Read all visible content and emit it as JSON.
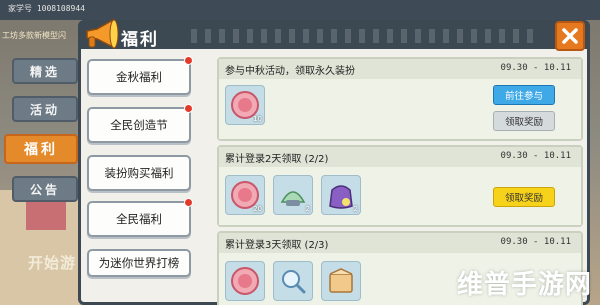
{
  "background": {
    "top_text": "家学号 1008108944",
    "sub_text": "工坊多款新模型闪",
    "start_text": "开始游"
  },
  "side_nav": [
    {
      "label": "精选",
      "active": false
    },
    {
      "label": "活动",
      "active": false
    },
    {
      "label": "福利",
      "active": true
    },
    {
      "label": "公告",
      "active": false
    }
  ],
  "panel": {
    "title": "福利",
    "close_icon": "close-x-icon"
  },
  "categories": [
    {
      "label": "金秋福利",
      "has_dot": true
    },
    {
      "label": "全民创造节",
      "has_dot": true
    },
    {
      "label": "装扮购买福利",
      "has_dot": false
    },
    {
      "label": "全民福利",
      "has_dot": true
    },
    {
      "label": "为迷你世界打榜",
      "has_dot": false
    }
  ],
  "cards": [
    {
      "title": "参与中秋活动，领取永久装扮",
      "date": "09.30 - 10.11",
      "items": [
        {
          "icon": "pink-coin-icon",
          "count": "10"
        }
      ],
      "buttons": [
        {
          "label": "前往参与",
          "style": "blue"
        },
        {
          "label": "领取奖励",
          "style": "gray"
        }
      ]
    },
    {
      "title": "累计登录2天领取 (2/2)",
      "date": "09.30 - 10.11",
      "items": [
        {
          "icon": "pink-coin-icon",
          "count": "20"
        },
        {
          "icon": "tree-seed-icon",
          "count": "2"
        },
        {
          "icon": "purple-bag-icon",
          "count": "2"
        }
      ],
      "buttons": [
        {
          "label": "领取奖励",
          "style": "yellow"
        }
      ]
    },
    {
      "title": "累计登录3天领取 (2/3)",
      "date": "09.30 - 10.11",
      "items": [
        {
          "icon": "pink-coin-icon",
          "count": ""
        },
        {
          "icon": "magnifier-icon",
          "count": ""
        },
        {
          "icon": "cookie-box-icon",
          "count": ""
        }
      ],
      "buttons": []
    }
  ],
  "watermark": "维普手游网",
  "colors": {
    "header_dark": "#3d4952",
    "accent_orange": "#e58a2a",
    "button_blue": "#3fa9e8",
    "button_yellow": "#f7d21a",
    "notify_red": "#e23b2c"
  }
}
